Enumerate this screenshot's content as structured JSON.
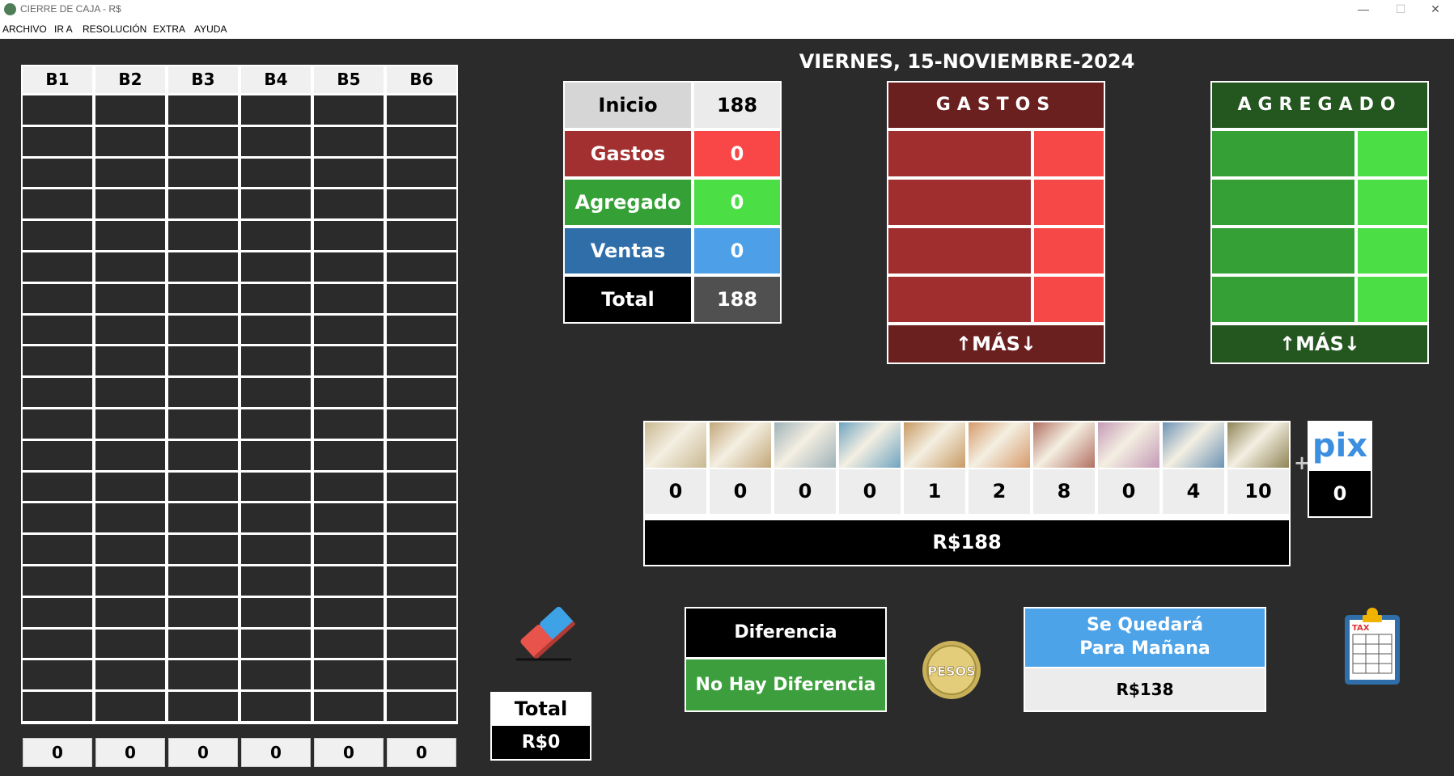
{
  "window": {
    "title": "CIERRE DE CAJA - R$",
    "minimize": "—",
    "maximize": "☐",
    "close": "✕"
  },
  "menu": [
    "ARCHIVO",
    "IR A",
    "RESOLUCIÓN",
    "EXTRA",
    "AYUDA"
  ],
  "grid": {
    "headers": [
      "B1",
      "B2",
      "B3",
      "B4",
      "B5",
      "B6"
    ],
    "totals": [
      "0",
      "0",
      "0",
      "0",
      "0",
      "0"
    ]
  },
  "date": "VIERNES, 15-NOVIEMBRE-2024",
  "summary": [
    {
      "label": "Inicio",
      "value": "188",
      "label_bg": "#d6d6d6",
      "value_bg": "#ebebeb",
      "text": "#000000"
    },
    {
      "label": "Gastos",
      "value": "0",
      "label_bg": "#a23030",
      "value_bg": "#f94646",
      "text": "#ffffff"
    },
    {
      "label": "Agregado",
      "value": "0",
      "label_bg": "#35a035",
      "value_bg": "#4bdf45",
      "text": "#ffffff"
    },
    {
      "label": "Ventas",
      "value": "0",
      "label_bg": "#2f6ea8",
      "value_bg": "#4d9fe8",
      "text": "#ffffff"
    },
    {
      "label": "Total",
      "value": "188",
      "label_bg": "#000000",
      "value_bg": "#505050",
      "text": "#ffffff"
    }
  ],
  "gastos": {
    "title": "GASTOS",
    "more": "↑MÁS↓",
    "colors": {
      "title": "#6b2020",
      "left": "#a02e2e",
      "right": "#f74848"
    }
  },
  "agregado": {
    "title": "AGREGADO",
    "more": "↑MÁS↓",
    "colors": {
      "title": "#24561f",
      "left": "#35a035",
      "right": "#4bdf45"
    }
  },
  "money": {
    "bills": [
      {
        "icon": "stack-200-bills-icon",
        "count": "0",
        "color": "#c9b891"
      },
      {
        "icon": "stack-100-bills-icon",
        "count": "0",
        "color": "#c2a77a"
      },
      {
        "icon": "200-reais-note-icon",
        "count": "0",
        "color": "#9fb2b8"
      },
      {
        "icon": "100-reais-note-icon",
        "count": "0",
        "color": "#6fa4c0"
      },
      {
        "icon": "50-reais-note-icon",
        "count": "1",
        "color": "#c79a63"
      },
      {
        "icon": "20-reais-note-icon",
        "count": "2",
        "color": "#d69a6a"
      },
      {
        "icon": "10-reais-note-icon",
        "count": "8",
        "color": "#b27062"
      },
      {
        "icon": "5-reais-note-icon",
        "count": "0",
        "color": "#c49ab6"
      },
      {
        "icon": "2-reais-note-icon",
        "count": "4",
        "color": "#6c93b5"
      },
      {
        "icon": "coins-icon",
        "count": "10",
        "color": "#8e8456"
      }
    ],
    "total": "R$188"
  },
  "pix": {
    "logo": "pix",
    "value": "0"
  },
  "total_box": {
    "label": "Total",
    "value": "R$0"
  },
  "diferencia": {
    "label": "Diferencia",
    "value": "No Hay Diferencia"
  },
  "coin_badge": "PESOS",
  "manana": {
    "label": "Se Quedará\nPara Mañana",
    "value": "R$138"
  },
  "tax_label": "TAX"
}
